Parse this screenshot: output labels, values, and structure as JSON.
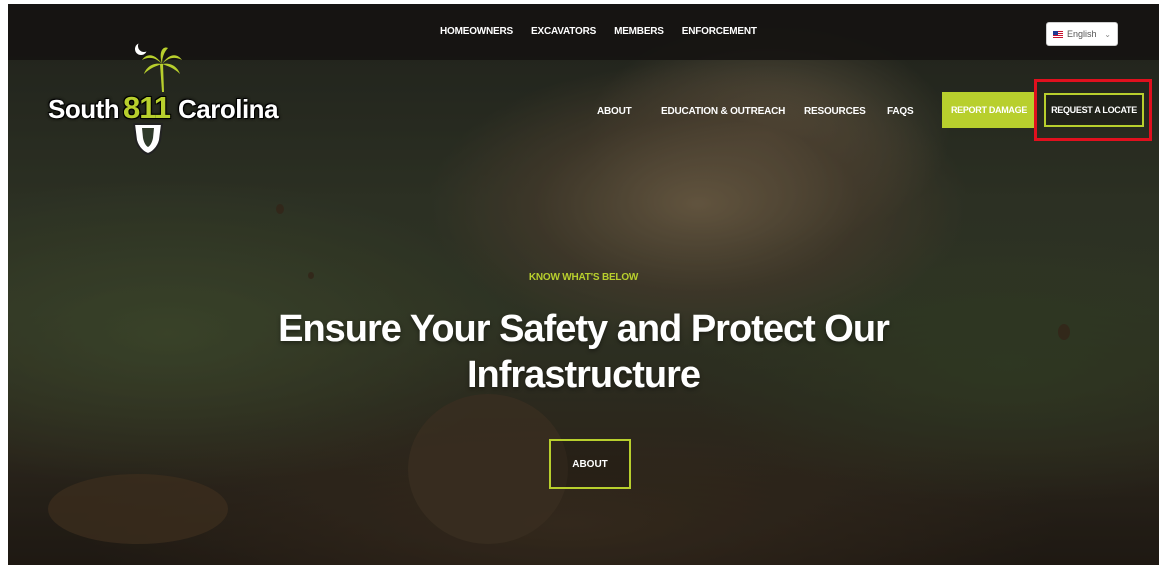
{
  "top_nav": [
    "HOMEOWNERS",
    "EXCAVATORS",
    "MEMBERS",
    "ENFORCEMENT"
  ],
  "language": {
    "selected": "English"
  },
  "logo": {
    "word_left": "South",
    "number": "811",
    "word_right": "Carolina"
  },
  "main_nav": {
    "about": "ABOUT",
    "education": "EDUCATION & OUTREACH",
    "resources": "RESOURCES",
    "faqs": "FAQS"
  },
  "buttons": {
    "report_damage": "REPORT DAMAGE",
    "request_locate": "REQUEST A LOCATE"
  },
  "hero": {
    "eyebrow": "KNOW WHAT'S BELOW",
    "title_line1": "Ensure Your Safety and Protect Our",
    "title_line2": "Infrastructure",
    "cta": "ABOUT"
  },
  "colors": {
    "accent": "#b8cf2d",
    "highlight_box": "#e0101e",
    "topbar": "#161411"
  }
}
